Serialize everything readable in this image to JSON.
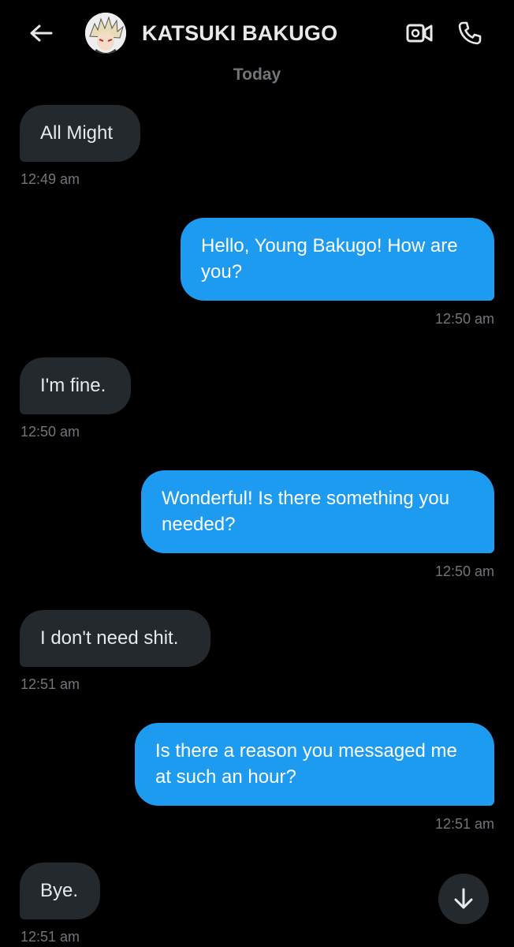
{
  "header": {
    "contact_name": "KATSUKI BAKUGO",
    "back_icon": "arrow-left-icon",
    "video_icon": "video-call-icon",
    "phone_icon": "phone-icon"
  },
  "date_separator": "Today",
  "messages": [
    {
      "direction": "received",
      "text": "All Might",
      "time": "12:49 am"
    },
    {
      "direction": "sent",
      "text": "Hello, Young Bakugo! How are you?",
      "time": "12:50 am"
    },
    {
      "direction": "received",
      "text": "I'm fine.",
      "time": "12:50 am"
    },
    {
      "direction": "sent",
      "text": "Wonderful! Is there something you needed?",
      "time": "12:50 am"
    },
    {
      "direction": "received",
      "text": "I don't need shit.",
      "time": "12:51 am"
    },
    {
      "direction": "sent",
      "text": "Is there a reason you messaged me at such an hour?",
      "time": "12:51 am"
    },
    {
      "direction": "received",
      "text": "Bye.",
      "time": "12:51 am"
    }
  ],
  "scroll_button_icon": "arrow-down-icon",
  "colors": {
    "background": "#000000",
    "sent_bubble": "#1d9bf0",
    "received_bubble": "#24292e",
    "timestamp": "#71767b"
  }
}
